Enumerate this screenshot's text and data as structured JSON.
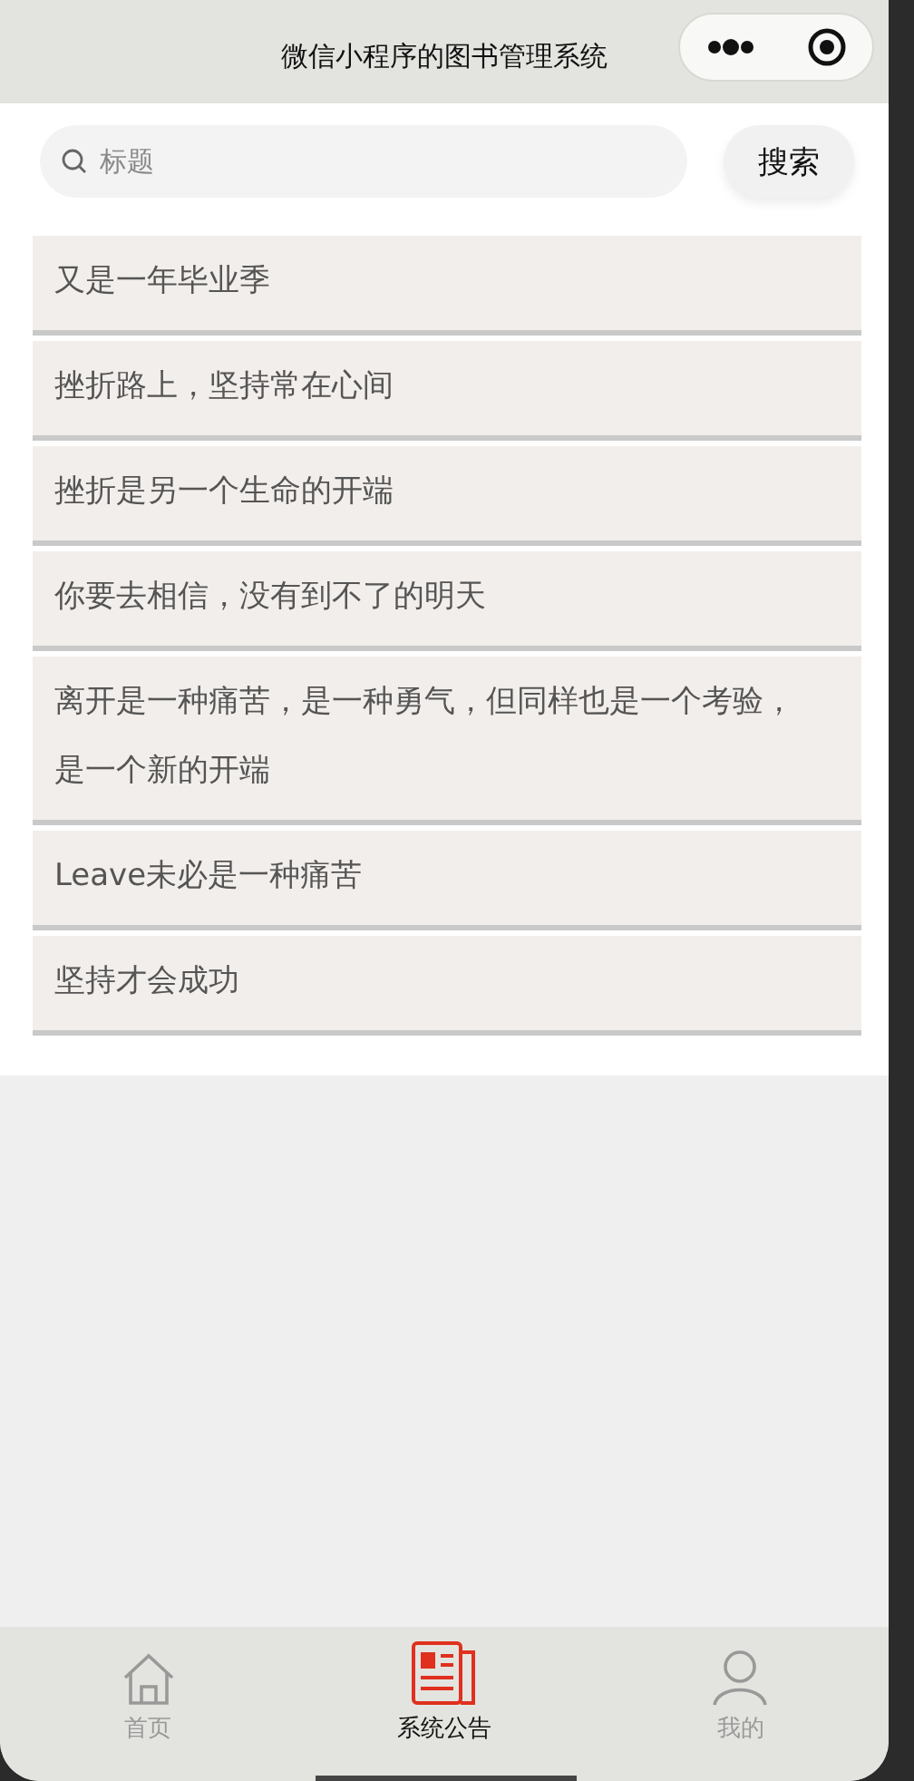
{
  "window": {
    "title": "微信小程序的图书管理系统"
  },
  "search": {
    "placeholder": "标题",
    "button": "搜索"
  },
  "notices": [
    {
      "title": "又是一年毕业季"
    },
    {
      "title": "挫折路上，坚持常在心间"
    },
    {
      "title": "挫折是另一个生命的开端"
    },
    {
      "title": "你要去相信，没有到不了的明天"
    },
    {
      "title": "离开是一种痛苦，是一种勇气，但同样也是一个考验，是一个新的开端"
    },
    {
      "title": "Leave未必是一种痛苦"
    },
    {
      "title": "坚持才会成功"
    }
  ],
  "tabs": [
    {
      "kind": "home",
      "label": "首页",
      "selected": false
    },
    {
      "kind": "news",
      "label": "系统公告",
      "selected": true
    },
    {
      "kind": "user",
      "label": "我的",
      "selected": false
    }
  ]
}
